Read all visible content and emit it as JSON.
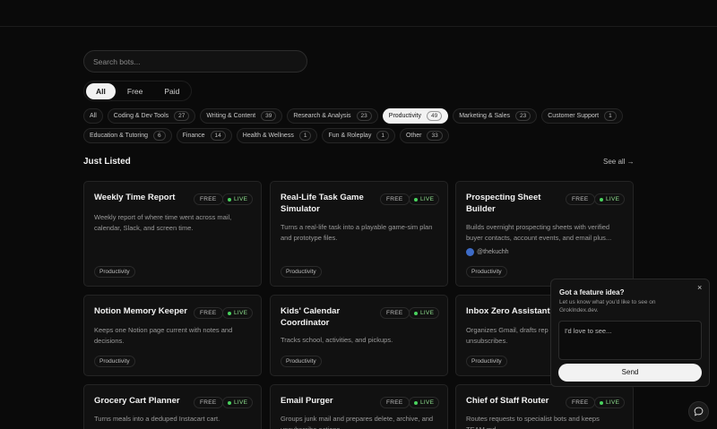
{
  "search": {
    "placeholder": "Search bots..."
  },
  "pricing": [
    "All",
    "Free",
    "Paid"
  ],
  "categories": [
    {
      "label": "All",
      "count": ""
    },
    {
      "label": "Coding & Dev Tools",
      "count": "27"
    },
    {
      "label": "Writing & Content",
      "count": "39"
    },
    {
      "label": "Research & Analysis",
      "count": "23"
    },
    {
      "label": "Productivity",
      "count": "49"
    },
    {
      "label": "Marketing & Sales",
      "count": "23"
    },
    {
      "label": "Customer Support",
      "count": "1"
    },
    {
      "label": "Education & Tutoring",
      "count": "6"
    },
    {
      "label": "Finance",
      "count": "14"
    },
    {
      "label": "Health & Wellness",
      "count": "1"
    },
    {
      "label": "Fun & Roleplay",
      "count": "1"
    },
    {
      "label": "Other",
      "count": "33"
    }
  ],
  "section": {
    "title": "Just Listed",
    "see_all": "See all →"
  },
  "badges": {
    "free": "FREE",
    "live": "LIVE"
  },
  "cards": [
    {
      "title": "Weekly Time Report",
      "desc": "Weekly report of where time went across mail, calendar, Slack, and screen time.",
      "tag": "Productivity"
    },
    {
      "title": "Real-Life Task Game Simulator",
      "desc": "Turns a real-life task into a playable game-sim plan and prototype files.",
      "tag": "Productivity"
    },
    {
      "title": "Prospecting Sheet Builder",
      "desc": "Builds overnight prospecting sheets with verified buyer contacts, account events, and email plus...",
      "author": "@thekuchh",
      "tag": "Productivity"
    },
    {
      "title": "Notion Memory Keeper",
      "desc": "Keeps one Notion page current with notes and decisions.",
      "tag": "Productivity"
    },
    {
      "title": "Kids' Calendar Coordinator",
      "desc": "Tracks school, activities, and pickups.",
      "tag": "Productivity"
    },
    {
      "title": "Inbox Zero Assistant",
      "desc": "Organizes Gmail, drafts rep unsubscribes.",
      "tag": "Productivity"
    },
    {
      "title": "Grocery Cart Planner",
      "desc": "Turns meals into a deduped Instacart cart.",
      "tag": ""
    },
    {
      "title": "Email Purger",
      "desc": "Groups junk mail and prepares delete, archive, and unsubscribe actions.",
      "tag": ""
    },
    {
      "title": "Chief of Staff Router",
      "desc": "Routes requests to specialist bots and keeps TEAM.md",
      "tag": ""
    }
  ],
  "feedback": {
    "title": "Got a feature idea?",
    "subtitle": "Let us know what you'd like to see on GrokIndex.dev.",
    "placeholder": "I'd love to see...",
    "send": "Send",
    "close": "×"
  },
  "colors": {
    "accent_live": "#49d35e",
    "background": "#0a0a0a",
    "card": "#111111"
  }
}
